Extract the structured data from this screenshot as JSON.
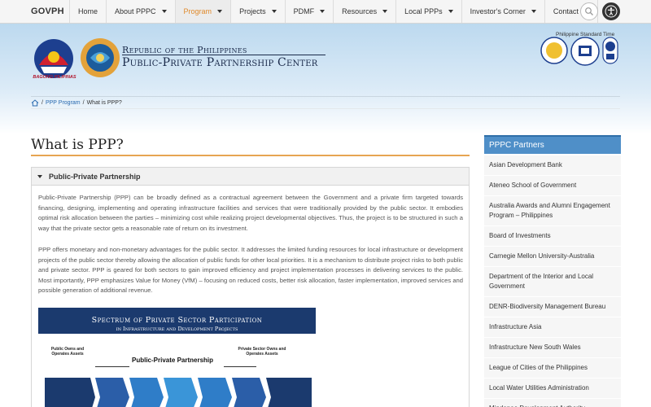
{
  "nav": {
    "brand": "GOVPH",
    "items": [
      {
        "label": "Home",
        "caret": false,
        "active": false
      },
      {
        "label": "About PPPC",
        "caret": true,
        "active": false
      },
      {
        "label": "Program",
        "caret": true,
        "active": true
      },
      {
        "label": "Projects",
        "caret": true,
        "active": false
      },
      {
        "label": "PDMF",
        "caret": true,
        "active": false
      },
      {
        "label": "Resources",
        "caret": true,
        "active": false
      },
      {
        "label": "Local PPPs",
        "caret": true,
        "active": false
      },
      {
        "label": "Investor's Corner",
        "caret": true,
        "active": false
      },
      {
        "label": "Contact Us",
        "caret": false,
        "active": false
      }
    ],
    "icons": [
      "search-icon",
      "accessibility-icon"
    ]
  },
  "header": {
    "bagong": "BAGONG PILIPINAS",
    "title_line1": "Republic of the Philippines",
    "title_line2": "Public-Private Partnership Center",
    "pst_label": "Philippine Standard Time"
  },
  "breadcrumb": {
    "home_icon": "home-icon",
    "parent": "PPP Program",
    "current": "What is PPP?"
  },
  "main": {
    "title": "What is PPP?",
    "panel_title": "Public-Private Partnership",
    "para1": "Public-Private Partnership (PPP) can be broadly defined as a contractual agreement between the Government and a private firm targeted towards financing, designing, implementing and operating infrastructure facilities and services that were traditionally provided by the public sector. It embodies optimal risk allocation between the parties – minimizing cost while realizing project developmental objectives. Thus, the project is to be structured in such a way that the private sector gets a reasonable rate of return on its investment.",
    "para2": "PPP offers monetary and non-monetary advantages for the public sector. It addresses the limited funding resources for local infrastructure or development projects of the public sector thereby allowing the allocation of public funds for other local priorities. It is a mechanism to distribute project risks to both public and private sector. PPP is geared for both sectors to gain improved efficiency and project implementation processes in delivering services to the public. Most importantly, PPP emphasizes Value for Money (VfM) – focusing on reduced costs, better risk allocation, faster implementation, improved services and possible generation of additional revenue.",
    "figure": {
      "title": "Spectrum of Private Sector Participation",
      "subtitle": "in Infrastructure and Development Projects",
      "left_label": "Public Owns and Operates Assets",
      "center_label": "Public-Private Partnership",
      "right_label": "Private Sector Owns and Operates Assets"
    }
  },
  "sidebar": {
    "title": "PPPC Partners",
    "items": [
      "Asian Development Bank",
      "Ateneo School of Government",
      "Australia Awards and Alumni Engagement Program – Philippines",
      "Board of Investments",
      "Carnegie Mellon University-Australia",
      "Department of the Interior and Local Government",
      "DENR-Biodiversity Management Bureau",
      "Infrastructure Asia",
      "Infrastructure New South Wales",
      "League of Cities of the Philippines",
      "Local Water Utilities Administration",
      "Mindanao Development Authority"
    ]
  },
  "colors": {
    "accent_orange": "#e08a2c",
    "sidebar_blue": "#4f8fc8",
    "header_blue": "#bcd9ef",
    "figure_navy": "#1b3a6e"
  }
}
